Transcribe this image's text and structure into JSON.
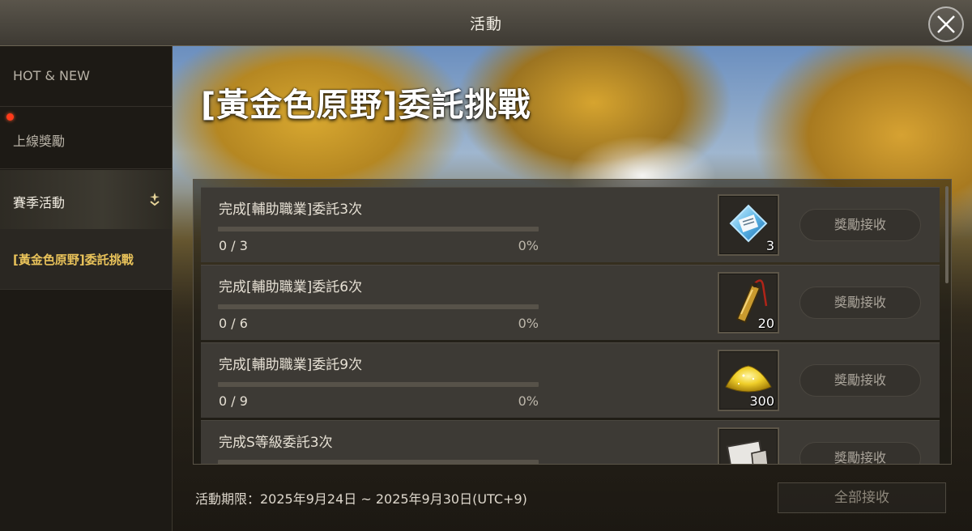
{
  "window": {
    "title": "活動"
  },
  "sidebar": {
    "items": [
      {
        "label": "HOT & NEW"
      },
      {
        "label": "上線獎勵"
      },
      {
        "label": "賽季活動"
      },
      {
        "label": "[黃金色原野]委託挑戰"
      }
    ]
  },
  "event": {
    "title": "[黃金色原野]委託挑戰",
    "missions": [
      {
        "title": "完成[輔助職業]委託3次",
        "count": "0 / 3",
        "percent": "0%",
        "progress": 0,
        "reward_icon": "blue-ticket-icon",
        "reward_qty": "3",
        "claim_label": "獎勵接收"
      },
      {
        "title": "完成[輔助職業]委託6次",
        "count": "0 / 6",
        "percent": "0%",
        "progress": 0,
        "reward_icon": "golden-tool-icon",
        "reward_qty": "20",
        "claim_label": "獎勵接收"
      },
      {
        "title": "完成[輔助職業]委託9次",
        "count": "0 / 9",
        "percent": "0%",
        "progress": 0,
        "reward_icon": "gold-dust-icon",
        "reward_qty": "300",
        "claim_label": "獎勵接收"
      },
      {
        "title": "完成S等級委託3次",
        "count": "",
        "percent": "",
        "progress": 0,
        "reward_icon": "document-icon",
        "reward_qty": "",
        "claim_label": "獎勵接收"
      }
    ],
    "period": "活動期限：2025年9月24日 ~ 2025年9月30日(UTC+9)",
    "claim_all_label": "全部接收"
  },
  "colors": {
    "accent_gold": "#e8c25a",
    "notification_dot": "#ff3a1a",
    "progress_fill": "#d7b24f"
  }
}
